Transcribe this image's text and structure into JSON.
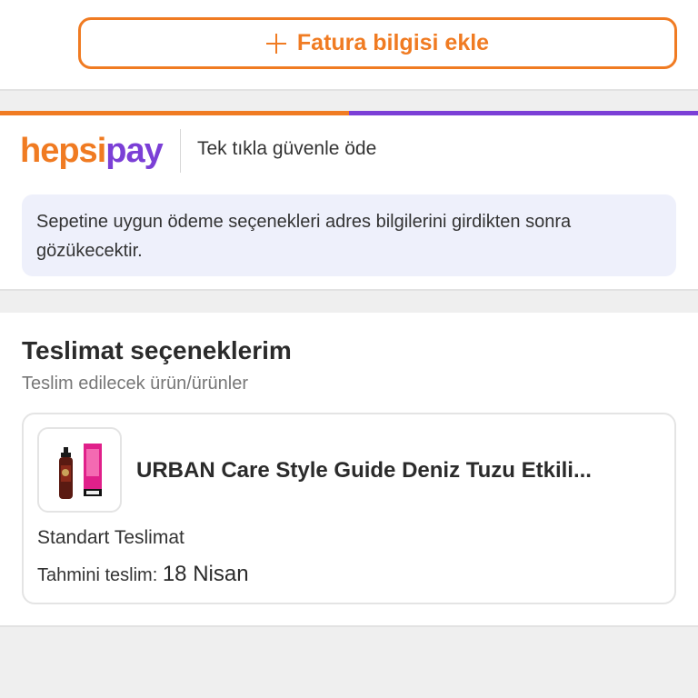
{
  "invoice": {
    "add_button_label": "Fatura bilgisi ekle"
  },
  "hepsipay": {
    "logo_part1": "hepsi",
    "logo_part2": "pay",
    "tagline": "Tek tıkla güvenle öde",
    "info_message": "Sepetine uygun ödeme seçenekleri adres bilgilerini girdikten sonra gözükecektir.",
    "brand_orange": "#f07b22",
    "brand_purple": "#7b3fd6"
  },
  "delivery": {
    "title": "Teslimat seçeneklerim",
    "subtitle": "Teslim edilecek ürün/ürünler",
    "product": {
      "name": "URBAN Care Style Guide Deniz Tuzu Etkili...",
      "image_icon": "product-bottle-icon"
    },
    "type_label": "Standart Teslimat",
    "estimate_label": "Tahmini teslim:",
    "estimate_date": "18 Nisan"
  }
}
